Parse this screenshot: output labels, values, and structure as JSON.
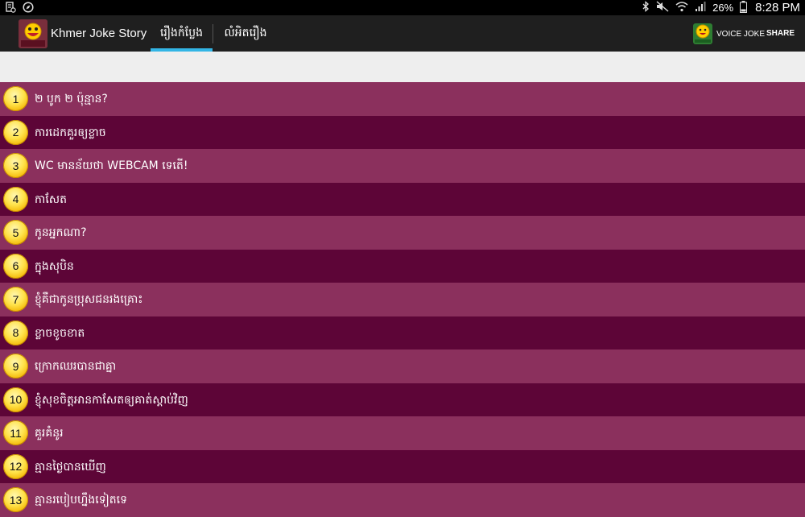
{
  "status_bar": {
    "battery": "26%",
    "time": "8:28 PM",
    "left_icons": [
      "notification-icon",
      "compass-icon"
    ],
    "right_icons": [
      "bluetooth-icon",
      "mute-icon",
      "wifi-icon",
      "signal-icon",
      "battery-icon"
    ]
  },
  "app_bar": {
    "title": "Khmer Joke Story",
    "tabs": [
      {
        "label": "រឿងកំប្លែង",
        "selected": true
      },
      {
        "label": "លំអិតរឿង",
        "selected": false
      }
    ],
    "voice_joke_label": "VOICE JOKE",
    "share_label": "SHARE",
    "accent_color": "#33b5e5"
  },
  "list": {
    "colors": {
      "light": "#8b305d",
      "dark": "#5d0537"
    },
    "items": [
      {
        "number": "1",
        "title": "២ បូក ២ ប៉ុន្មាន?"
      },
      {
        "number": "2",
        "title": "ការដេកគួរឲ្យខ្លាច"
      },
      {
        "number": "3",
        "title": "WC មានន័យថា WEBCAM ទេតើ!"
      },
      {
        "number": "4",
        "title": "កាសែត"
      },
      {
        "number": "5",
        "title": "កូនអ្នកណា?"
      },
      {
        "number": "6",
        "title": "ក្នុងសុបិន"
      },
      {
        "number": "7",
        "title": "ខ្ញុំគឺជាកូនប្រុសជនរងគ្រោះ"
      },
      {
        "number": "8",
        "title": "ខ្លាចខូចខាត"
      },
      {
        "number": "9",
        "title": "ក្រោកឈរបានជាគ្នា"
      },
      {
        "number": "10",
        "title": "ខ្ញុំសុខចិត្តអានកាសែតឲ្យគាត់ស្តាប់វិញ"
      },
      {
        "number": "11",
        "title": "គួរគំនូរ"
      },
      {
        "number": "12",
        "title": "គ្មានថ្ងៃបានឃើញ"
      },
      {
        "number": "13",
        "title": "គ្មានរបៀបហ្នឹងទៀតទេ"
      }
    ]
  }
}
